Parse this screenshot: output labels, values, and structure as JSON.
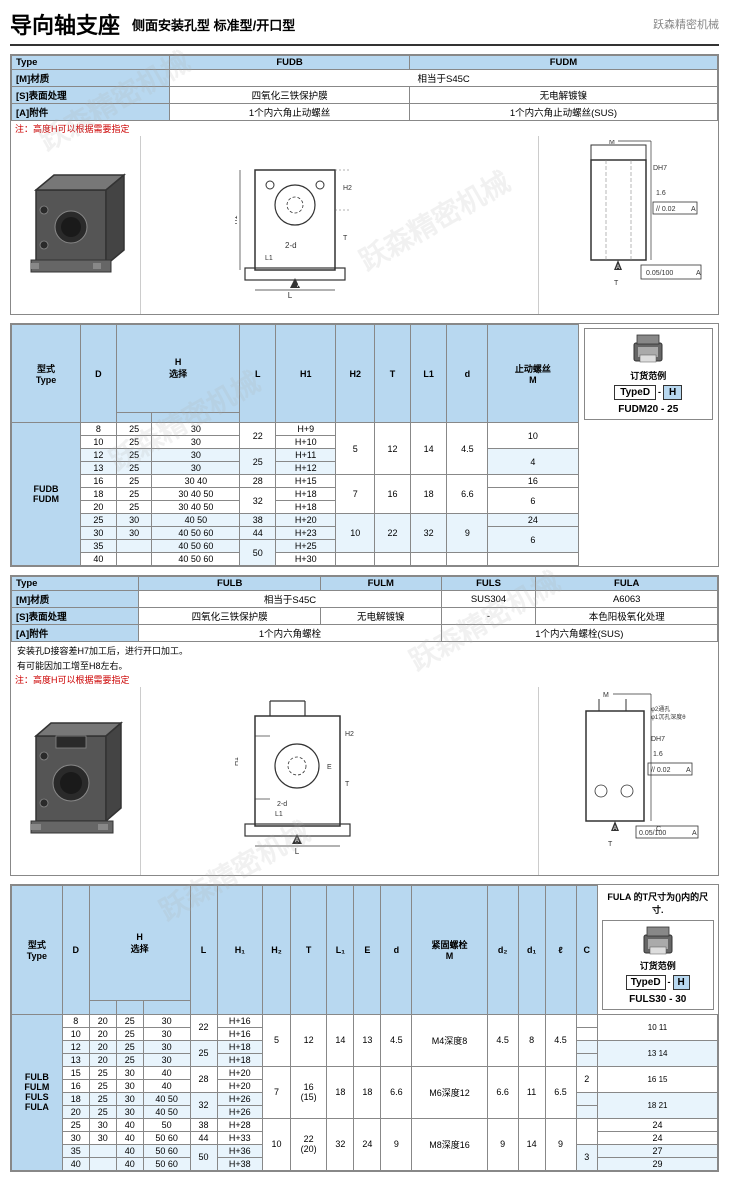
{
  "header": {
    "title_main": "导向轴支座",
    "subtitle": "侧面安装孔型  标准型/开口型",
    "logo": "跃森精密机械"
  },
  "section1": {
    "info": {
      "type_label": "Type",
      "type_values": [
        "FUDB",
        "FUDM"
      ],
      "material_label": "[M]材质",
      "material_value": "相当于S45C",
      "surface_label": "[S]表面处理",
      "surface_fudb": "四氧化三铁保护膜",
      "surface_fudm": "无电解镀镍",
      "accessory_label": "[A]附件",
      "accessory_fudb": "1个内六角止动螺丝",
      "accessory_fudm": "1个内六角止动螺丝(SUS)",
      "note": "注：高度H可以根据需要指定"
    },
    "table": {
      "headers": [
        "型式",
        "H",
        "",
        "L",
        "H1",
        "H2",
        "T",
        "L1",
        "d",
        "止动螺丝 M"
      ],
      "sub_headers": [
        "Type",
        "D",
        "选择",
        "",
        "",
        "",
        "",
        "",
        "",
        ""
      ],
      "type_label": "FUDB\nFUDM",
      "rows": [
        {
          "d": "8",
          "h_vals": [
            "25",
            "30"
          ],
          "l": "22",
          "h1": "H+9",
          "h2": "",
          "t": "",
          "l1": "",
          "screw": "10"
        },
        {
          "d": "10",
          "h_vals": [
            "25",
            "30"
          ],
          "l": "22",
          "h1": "H+10"
        },
        {
          "d": "12",
          "h_vals": [
            "25",
            "30"
          ],
          "l": "25",
          "h1": "H+11",
          "h2": "5",
          "t": "12",
          "l1": "14",
          "d_val": "4.5",
          "screw": "4"
        },
        {
          "d": "13",
          "h_vals": [
            "25",
            "30"
          ],
          "l": "25",
          "h1": "H+12"
        },
        {
          "d": "16",
          "h_vals": [
            "25",
            "30",
            "40"
          ],
          "l": "28",
          "h1": "H+15",
          "screw": "16"
        },
        {
          "d": "18",
          "h_vals": [
            "25",
            "30",
            "40",
            "50"
          ],
          "l": "32",
          "h1": "H+18",
          "h2": "7",
          "t": "16",
          "l1": "18",
          "d_val": "6.6",
          "screw": "6"
        },
        {
          "d": "20",
          "h_vals": [
            "25",
            "30",
            "40",
            "50"
          ],
          "l": "32",
          "h1": "H+18",
          "screw": "24"
        },
        {
          "d": "25",
          "h_vals": [
            "30",
            "40",
            "50"
          ],
          "l": "38",
          "h1": "H+20"
        },
        {
          "d": "30",
          "h_vals": [
            "30",
            "40",
            "50",
            "60"
          ],
          "l": "44",
          "h1": "H+23",
          "h2": "10",
          "t": "22",
          "l1": "32",
          "d_val": "9",
          "screw": "6"
        },
        {
          "d": "35",
          "h_vals": [
            "40",
            "50",
            "60"
          ],
          "l": "50",
          "h1": "H+25"
        },
        {
          "d": "40",
          "h_vals": [
            "40",
            "50",
            "60"
          ],
          "l": "50",
          "h1": "H+30"
        }
      ]
    },
    "order": {
      "title": "订货范例",
      "type_box": "TypeD",
      "dash": "-",
      "h_box": "H",
      "code": "FUDM20  -  25"
    }
  },
  "section2": {
    "info": {
      "type_label": "Type",
      "type_values": [
        "FULB",
        "FULM",
        "FULS",
        "FULA"
      ],
      "material_label": "[M]材质",
      "material_value": "相当于S45C",
      "material_fuls": "SUS304",
      "material_fula": "A6063",
      "surface_label": "[S]表面处理",
      "surface_fulb": "四氧化三铁保护膜",
      "surface_fulm": "无电解镀镍",
      "surface_fuls": "-",
      "surface_fula": "本色阳极氧化处理",
      "accessory_label": "[A]附件",
      "accessory_fulb": "1个内六角螺栓",
      "accessory_fula": "1个内六角螺栓(SUS)",
      "note1": "安装孔D接容差H7加工后，进行开口加工。",
      "note2": "有可能因加工增至H8左右。",
      "note3": "注：高度H可以根据需要指定"
    },
    "table": {
      "headers": [
        "型式",
        "H",
        "",
        "L",
        "H1",
        "H2",
        "T",
        "L1",
        "E",
        "d",
        "紧固螺栓 M",
        "d2",
        "d1",
        "ℓ",
        "C"
      ],
      "sub_headers": [
        "Type",
        "D",
        "选择",
        "",
        "",
        "",
        "",
        "",
        "",
        "",
        "",
        "",
        "",
        "",
        ""
      ],
      "type_label": "FULB\nFULM\nFULS\nFULA",
      "rows": [
        {
          "d": "8",
          "h_vals": [
            "20",
            "25",
            "30"
          ],
          "l": "22",
          "h1": "H+16",
          "screw": "10",
          "e2": "11"
        },
        {
          "d": "10",
          "h_vals": [
            "20",
            "25",
            "30"
          ],
          "l": "22",
          "h1": "H+16"
        },
        {
          "d": "12",
          "h_vals": [
            "20",
            "25",
            "30"
          ],
          "l": "25",
          "h1": "H+18",
          "h2": "5",
          "t": "12",
          "l1": "14",
          "e": "13",
          "d_val": "4.5",
          "screw": "M4深度8",
          "d2": "4.5",
          "d1": "8",
          "l_val": "4.5"
        },
        {
          "d": "13",
          "h_vals": [
            "20",
            "25",
            "30"
          ],
          "l": "25",
          "h1": "H+18"
        },
        {
          "d": "15",
          "h_vals": [
            "25",
            "30",
            "40"
          ],
          "l": "28",
          "h1": "H+20",
          "c": "2"
        },
        {
          "d": "16",
          "h_vals": [
            "25",
            "30",
            "40"
          ],
          "l": "28",
          "h1": "H+20"
        },
        {
          "d": "18",
          "h_vals": [
            "25",
            "30",
            "40",
            "50"
          ],
          "l": "32",
          "h1": "H+26",
          "h2": "7",
          "t": "16(15)",
          "l1": "18",
          "e": "18",
          "d_val": "6.6",
          "screw": "M6深度12",
          "d2": "6.6",
          "d1": "11",
          "l_val": "6.5"
        },
        {
          "d": "20",
          "h_vals": [
            "25",
            "30",
            "40",
            "50"
          ],
          "l": "32",
          "h1": "H+26",
          "e2": "21"
        },
        {
          "d": "25",
          "h_vals": [
            "30",
            "40",
            "50"
          ],
          "l": "38",
          "h1": "H+28",
          "e2": "24"
        },
        {
          "d": "30",
          "h_vals": [
            "30",
            "40",
            "50",
            "60"
          ],
          "l": "44",
          "h1": "H+33",
          "h2": "10",
          "t": "22(20)",
          "l1": "32",
          "e2": "24",
          "d_val": "9",
          "screw": "M8深度16",
          "d2": "9",
          "d1": "14",
          "l_val": "9",
          "c": "3"
        },
        {
          "d": "35",
          "h_vals": [
            "40",
            "50",
            "60"
          ],
          "l": "50",
          "h1": "H+36",
          "e2": "27"
        },
        {
          "d": "40",
          "h_vals": [
            "40",
            "50",
            "60"
          ],
          "l": "50",
          "h1": "H+38",
          "e2": "29"
        }
      ]
    },
    "fula_note": "FULA 的T尺寸为()内的尺寸.",
    "order": {
      "title": "订货范例",
      "type_box": "TypeD",
      "dash": "-",
      "h_box": "H",
      "code": "FULS30  -  30"
    }
  }
}
